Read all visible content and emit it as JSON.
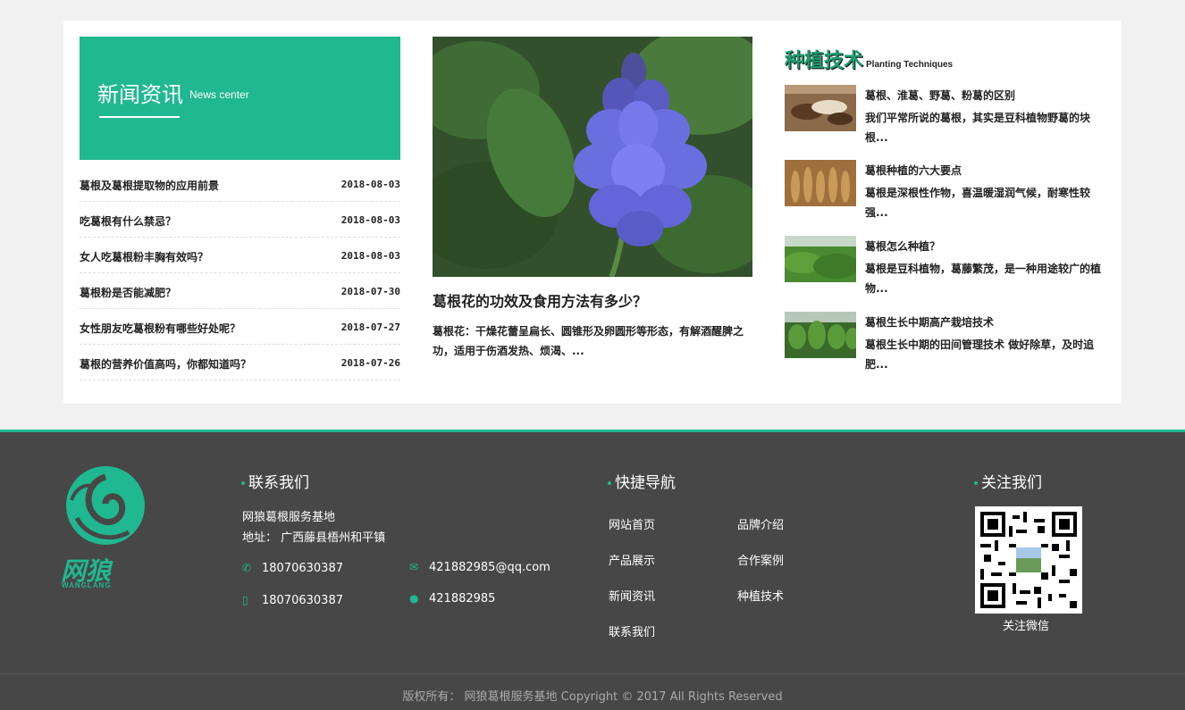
{
  "news": {
    "title_cn": "新闻资讯",
    "title_en": "News center",
    "items": [
      {
        "title": "葛根及葛根提取物的应用前景",
        "date": "2018-08-03"
      },
      {
        "title": "吃葛根有什么禁忌？",
        "date": "2018-08-03"
      },
      {
        "title": "女人吃葛根粉丰胸有效吗？",
        "date": "2018-08-03"
      },
      {
        "title": "葛根粉是否能减肥？",
        "date": "2018-07-30"
      },
      {
        "title": "女性朋友吃葛根粉有哪些好处呢？",
        "date": "2018-07-27"
      },
      {
        "title": "葛根的营养价值高吗，你都知道吗？",
        "date": "2018-07-26"
      }
    ]
  },
  "feature": {
    "image_icon": "purple-lupine-flower-photo",
    "title": "葛根花的功效及食用方法有多少？",
    "desc": "葛根花：干燥花蕾呈扁长、圆锥形及卵圆形等形态，有解酒醒脾之功，适用于伤酒发热、烦渴、..."
  },
  "tech": {
    "title_cn": "种植技术",
    "title_en": "Planting Techniques",
    "items": [
      {
        "title": "葛根、淮葛、野葛、粉葛的区别",
        "desc": "我们平常所说的葛根，其实是豆科植物野葛的块根...",
        "thumb_icon": "kudzu-roots-photo"
      },
      {
        "title": "葛根种植的六大要点",
        "desc": "葛根是深根性作物，喜温暖湿润气候，耐寒性较强...",
        "thumb_icon": "kudzu-harvest-photo"
      },
      {
        "title": "葛根怎么种植？",
        "desc": "葛根是豆科植物，葛藤繁茂，是一种用途较广的植物...",
        "thumb_icon": "kudzu-field-photo"
      },
      {
        "title": "葛根生长中期高产栽培技术",
        "desc": "葛根生长中期的田间管理技术 做好除草，及时追肥...",
        "thumb_icon": "kudzu-vines-photo"
      }
    ]
  },
  "footer": {
    "brand_cn": "网狼",
    "brand_en": "WANGLANG",
    "contact": {
      "heading": "联系我们",
      "name": "网狼葛根服务基地",
      "address": "地址： 广西藤县梧州和平镇",
      "phone": "18070630387",
      "mobile": "18070630387",
      "email": "421882985@qq.com",
      "qq": "421882985"
    },
    "nav": {
      "heading": "快捷导航",
      "links": [
        "网站首页",
        "品牌介绍",
        "产品展示",
        "合作案例",
        "新闻资讯",
        "种植技术",
        "联系我们"
      ]
    },
    "follow": {
      "heading": "关注我们",
      "qr_caption": "关注微信"
    },
    "copyright": "版权所有： 网狼葛根服务基地 Copyright © 2017 All Rights Reserved"
  },
  "colors": {
    "accent": "#20b890",
    "footer_bg": "#474747",
    "page_bg": "#f1f1f1"
  }
}
